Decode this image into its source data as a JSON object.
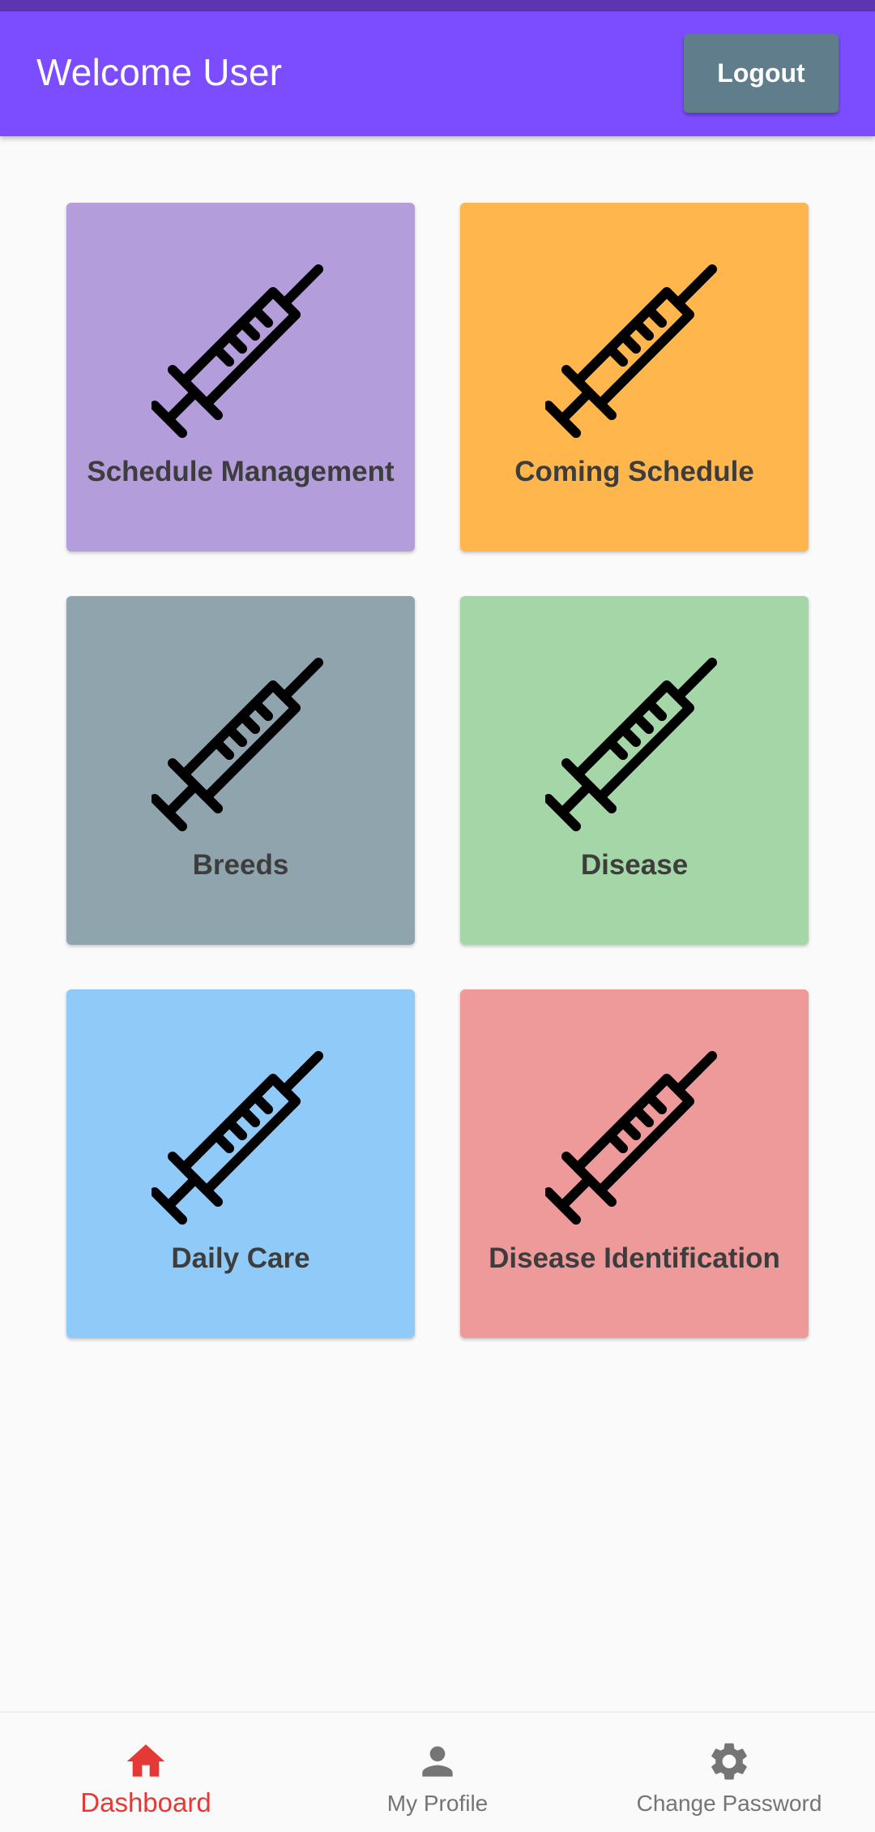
{
  "app_bar": {
    "title": "Welcome User",
    "logout_label": "Logout"
  },
  "colors": {
    "primary": "#7c4dff",
    "status_bar": "#5e35b1",
    "logout_button": "#607d8b",
    "active_nav": "#e53935",
    "inactive_nav": "#757575"
  },
  "tiles": [
    {
      "label": "Schedule Management",
      "color": "#b39ddb",
      "icon": "syringe-icon"
    },
    {
      "label": "Coming Schedule",
      "color": "#ffb74d",
      "icon": "syringe-icon"
    },
    {
      "label": "Breeds",
      "color": "#90a4ae",
      "icon": "syringe-icon"
    },
    {
      "label": "Disease",
      "color": "#a5d6a7",
      "icon": "syringe-icon"
    },
    {
      "label": "Daily Care",
      "color": "#90caf9",
      "icon": "syringe-icon"
    },
    {
      "label": "Disease Identification",
      "color": "#ef9a9a",
      "icon": "syringe-icon"
    }
  ],
  "bottom_nav": [
    {
      "label": "Dashboard",
      "icon": "home-icon",
      "active": true
    },
    {
      "label": "My Profile",
      "icon": "person-icon",
      "active": false
    },
    {
      "label": "Change Password",
      "icon": "gear-icon",
      "active": false
    }
  ]
}
